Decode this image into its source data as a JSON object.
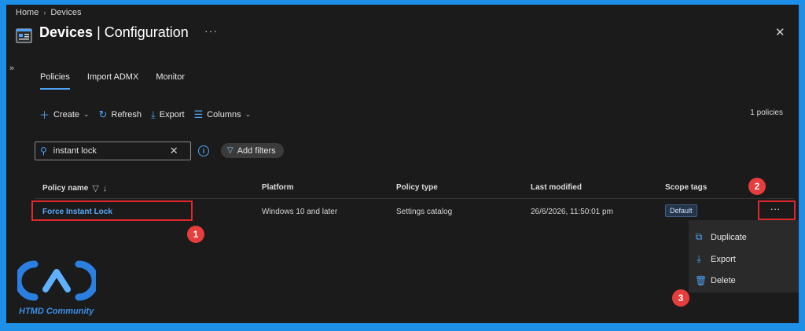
{
  "breadcrumb": {
    "items": [
      "Home",
      "Devices"
    ]
  },
  "header": {
    "title_bold": "Devices",
    "title_rest": " | Configuration",
    "more": "···",
    "close": "✕"
  },
  "sidebar": {
    "expand": "»"
  },
  "tabs": [
    {
      "label": "Policies",
      "active": true
    },
    {
      "label": "Import ADMX",
      "active": false
    },
    {
      "label": "Monitor",
      "active": false
    }
  ],
  "toolbar": {
    "create": "Create",
    "refresh": "Refresh",
    "export": "Export",
    "columns": "Columns",
    "count": "1 policies"
  },
  "search": {
    "value": "instant lock",
    "placeholder": "Search"
  },
  "filters": {
    "label": "Add filters"
  },
  "table": {
    "columns": [
      "Policy name",
      "Platform",
      "Policy type",
      "Last modified",
      "Scope tags"
    ],
    "rows": [
      {
        "name": "Force Instant Lock",
        "platform": "Windows 10 and later",
        "type": "Settings catalog",
        "modified": "26/6/2026, 11:50:01 pm",
        "scope": "Default"
      }
    ],
    "row_more": "···"
  },
  "context_menu": {
    "items": [
      "Duplicate",
      "Export",
      "Delete"
    ]
  },
  "callouts": [
    "1",
    "2",
    "3"
  ],
  "watermark": {
    "text": "HTMD Community"
  },
  "colors": {
    "accent": "#4fa3f7",
    "highlight": "#e2272d",
    "callout": "#e63d3d",
    "background": "#1b1b1b",
    "border": "#1e8fe6"
  }
}
